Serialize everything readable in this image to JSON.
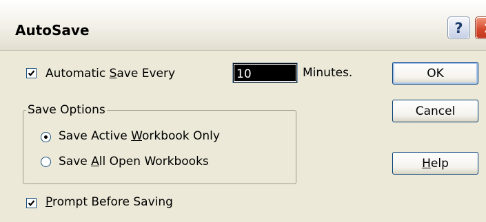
{
  "dialog": {
    "title": "AutoSave",
    "help_glyph": "?",
    "close_icon": "close-icon"
  },
  "autosave": {
    "checked": true,
    "label_pre": "Automatic ",
    "label_ul": "S",
    "label_post": "ave Every",
    "minutes_value": "10",
    "minutes_suffix": "Minutes."
  },
  "save_options": {
    "legend": "Save Options",
    "option1": {
      "pre": "Save Active ",
      "ul": "W",
      "post": "orkbook Only",
      "selected": true
    },
    "option2": {
      "pre": "Save ",
      "ul": "A",
      "post": "ll Open Workbooks",
      "selected": false
    }
  },
  "prompt": {
    "checked": true,
    "ul": "P",
    "post": "rompt Before Saving"
  },
  "buttons": {
    "ok": "OK",
    "cancel": "Cancel",
    "help_ul": "H",
    "help_post": "elp"
  }
}
